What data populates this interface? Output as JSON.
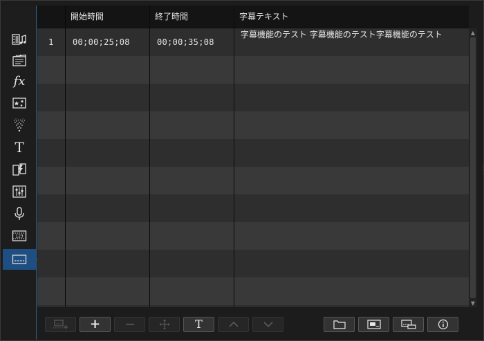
{
  "sidebar": {
    "items": [
      {
        "name": "media-room-icon"
      },
      {
        "name": "clip-room-icon"
      },
      {
        "name": "fx-room-icon",
        "label": "fx"
      },
      {
        "name": "pip-objects-icon"
      },
      {
        "name": "particle-room-icon"
      },
      {
        "name": "title-room-icon",
        "label": "T"
      },
      {
        "name": "transition-room-icon"
      },
      {
        "name": "audio-mixing-icon"
      },
      {
        "name": "voice-over-icon"
      },
      {
        "name": "chapter-room-icon"
      },
      {
        "name": "subtitle-room-icon",
        "active": true
      }
    ]
  },
  "table": {
    "headers": {
      "index": "",
      "start": "開始時間",
      "end": "終了時間",
      "text": "字幕テキスト"
    },
    "rows": [
      {
        "index": "1",
        "start": "00;00;25;08",
        "end": "00;00;35;08",
        "text": "字幕機能のテスト 字幕機能のテスト字幕機能のテスト"
      }
    ]
  },
  "toolbar": {
    "title_button_label": "T",
    "add_button_label": "+"
  },
  "colors": {
    "accent": "#1f4f82",
    "arrow": "#3a9af0",
    "header_bg": "#141414",
    "row_odd": "#2e2e2e",
    "row_even": "#393939"
  }
}
